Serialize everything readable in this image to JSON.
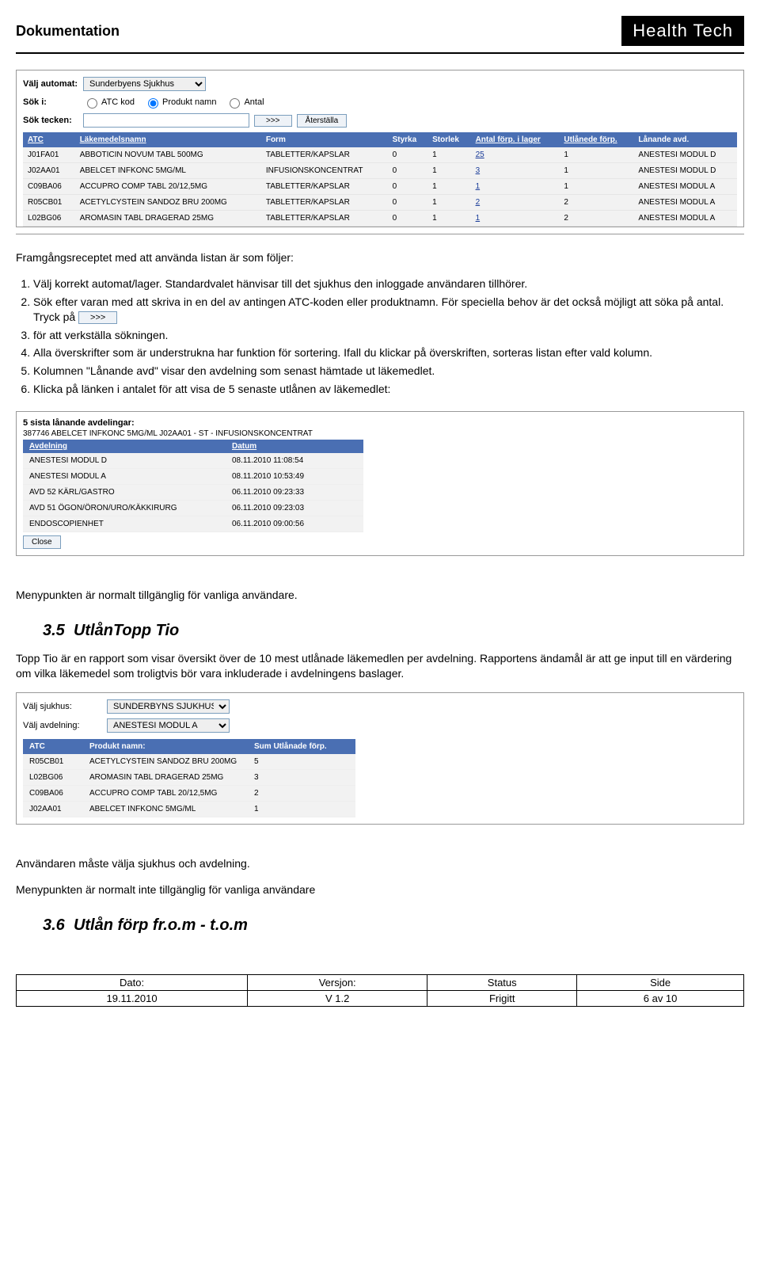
{
  "header": {
    "title": "Dokumentation",
    "brand": "Health Tech"
  },
  "app1": {
    "valj_automat_lbl": "Välj automat:",
    "valj_automat_val": "Sunderbyens Sjukhus",
    "sok_i_lbl": "Sök i:",
    "radio_atc": "ATC kod",
    "radio_prod": "Produkt namn",
    "radio_antal": "Antal",
    "sok_tecken_lbl": "Sök tecken:",
    "go_btn": ">>>",
    "reset_btn": "Återställa",
    "cols": {
      "atc": "ATC",
      "namn": "Läkemedelsnamn",
      "form": "Form",
      "styrka": "Styrka",
      "storlek": "Storlek",
      "antal": "Antal förp. i lager",
      "utl": "Utlånede förp.",
      "avd": "Lånande avd."
    },
    "rows": [
      {
        "atc": "J01FA01",
        "namn": "ABBOTICIN NOVUM TABL 500MG",
        "form": "TABLETTER/KAPSLAR",
        "styrka": "0",
        "storlek": "1",
        "antal": "25",
        "utl": "1",
        "avd": "ANESTESI MODUL D"
      },
      {
        "atc": "J02AA01",
        "namn": "ABELCET INFKONC 5MG/ML",
        "form": "INFUSIONSKONCENTRAT",
        "styrka": "0",
        "storlek": "1",
        "antal": "3",
        "utl": "1",
        "avd": "ANESTESI MODUL D"
      },
      {
        "atc": "C09BA06",
        "namn": "ACCUPRO COMP TABL 20/12,5MG",
        "form": "TABLETTER/KAPSLAR",
        "styrka": "0",
        "storlek": "1",
        "antal": "1",
        "utl": "1",
        "avd": "ANESTESI MODUL A"
      },
      {
        "atc": "R05CB01",
        "namn": "ACETYLCYSTEIN SANDOZ BRU 200MG",
        "form": "TABLETTER/KAPSLAR",
        "styrka": "0",
        "storlek": "1",
        "antal": "2",
        "utl": "2",
        "avd": "ANESTESI MODUL A"
      },
      {
        "atc": "L02BG06",
        "namn": "AROMASIN TABL DRAGERAD 25MG",
        "form": "TABLETTER/KAPSLAR",
        "styrka": "0",
        "storlek": "1",
        "antal": "1",
        "utl": "2",
        "avd": "ANESTESI MODUL A"
      }
    ]
  },
  "text1": "Framgångsreceptet med att använda listan är som följer:",
  "inst": {
    "i1": "Välj korrekt automat/lager. Standardvalet hänvisar till det sjukhus den inloggade användaren tillhörer.",
    "i2a": "Sök efter varan med att skriva in en del av antingen ATC-koden eller produktnamn. För speciella behov är det också möjligt att söka på antal. Tryck på ",
    "i2btn": ">>>",
    "i3": "för att verkställa sökningen.",
    "i4": "Alla överskrifter som är understrukna har funktion för sortering. Ifall du klickar på överskriften, sorteras listan efter vald kolumn.",
    "i5": "Kolumnen \"Lånande avd\" visar den avdelning som senast hämtade ut läkemedlet.",
    "i6": "Klicka på länken i antalet för att visa de 5 senaste utlånen av läkemedlet:"
  },
  "sub": {
    "title": "5 sista lånande avdelingar:",
    "line": "387746 ABELCET INFKONC 5MG/ML J02AA01 - ST - INFUSIONSKONCENTRAT",
    "cols": {
      "avd": "Avdelning",
      "datum": "Datum"
    },
    "rows": [
      {
        "avd": "ANESTESI MODUL D",
        "datum": "08.11.2010 11:08:54"
      },
      {
        "avd": "ANESTESI MODUL A",
        "datum": "08.11.2010 10:53:49"
      },
      {
        "avd": "AVD 52 KÄRL/GASTRO",
        "datum": "06.11.2010 09:23:33"
      },
      {
        "avd": "AVD 51 ÖGON/ÖRON/URO/KÄKKIRURG",
        "datum": "06.11.2010 09:23:03"
      },
      {
        "avd": "ENDOSCOPIENHET",
        "datum": "06.11.2010 09:00:56"
      }
    ],
    "close": "Close"
  },
  "text2": "Menypunkten är normalt tillgänglig för vanliga användare.",
  "sec35": {
    "num": "3.5",
    "title": "UtlånTopp Tio"
  },
  "text3": "Topp Tio är en rapport som visar översikt över de 10 mest utlånade läkemedlen per avdelning. Rapportens ändamål är att ge input till en värdering om vilka läkemedel som troligtvis bör vara inkluderade i avdelningens baslager.",
  "top": {
    "sjukhus_lbl": "Välj sjukhus:",
    "sjukhus_val": "SUNDERBYNS SJUKHUS",
    "avd_lbl": "Välj avdelning:",
    "avd_val": "ANESTESI MODUL A",
    "cols": {
      "atc": "ATC",
      "prod": "Produkt namn:",
      "sum": "Sum Utlånade förp."
    },
    "rows": [
      {
        "atc": "R05CB01",
        "prod": "ACETYLCYSTEIN SANDOZ BRU 200MG",
        "sum": "5"
      },
      {
        "atc": "L02BG06",
        "prod": "AROMASIN TABL DRAGERAD 25MG",
        "sum": "3"
      },
      {
        "atc": "C09BA06",
        "prod": "ACCUPRO COMP TABL 20/12,5MG",
        "sum": "2"
      },
      {
        "atc": "J02AA01",
        "prod": "ABELCET INFKONC 5MG/ML",
        "sum": "1"
      }
    ]
  },
  "text4": "Användaren måste välja sjukhus och avdelning.",
  "text5": "Menypunkten är normalt inte tillgänglig för vanliga användare",
  "sec36": {
    "num": "3.6",
    "title": "Utlån förp fr.o.m - t.o.m"
  },
  "footer": {
    "h1": "Dato:",
    "h2": "Versjon:",
    "h3": "Status",
    "h4": "Side",
    "v1": "19.11.2010",
    "v2": "V 1.2",
    "v3": "Frigitt",
    "v4": "6 av 10"
  }
}
